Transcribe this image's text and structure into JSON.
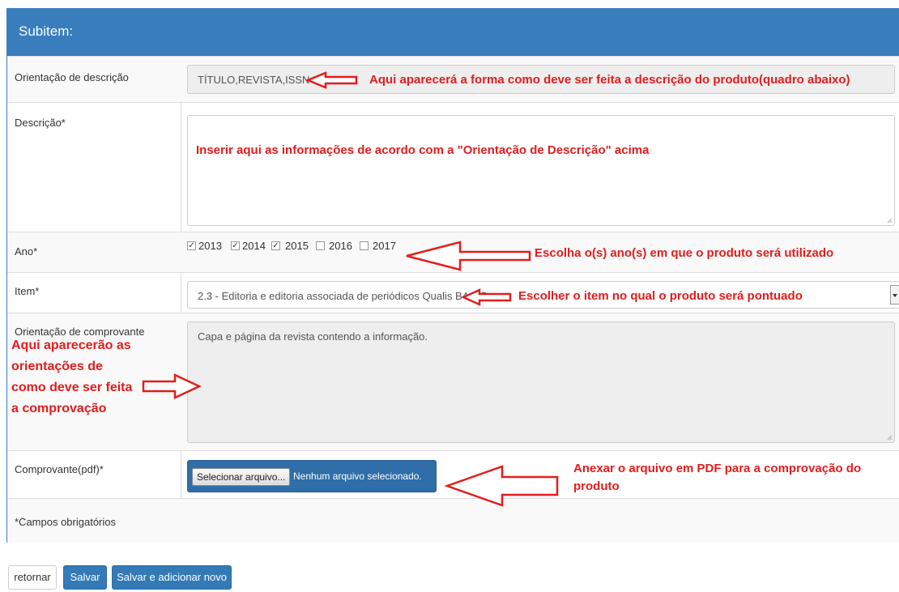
{
  "panel": {
    "title": "Subitem:"
  },
  "rows": {
    "orientacao_descricao": {
      "label": "Orientação de descrição",
      "value": "TÍTULO,REVISTA,ISSN"
    },
    "descricao": {
      "label": "Descrição*"
    },
    "ano": {
      "label": "Ano*",
      "years": [
        {
          "label": "2013",
          "checked": true
        },
        {
          "label": "2014",
          "checked": true
        },
        {
          "label": "2015",
          "checked": true
        },
        {
          "label": "2016",
          "checked": false
        },
        {
          "label": "2017",
          "checked": false
        }
      ]
    },
    "item": {
      "label": "Item*",
      "value": "2.3 - Editoria e editoria associada de periódicos Qualis B4, B5"
    },
    "orientacao_comprovante": {
      "label": "Orientação de comprovante",
      "value": "Capa e página da revista contendo a informação."
    },
    "comprovante": {
      "label": "Comprovante(pdf)*",
      "button": "Selecionar arquivo...",
      "status": "Nenhum arquivo selecionado."
    },
    "obrigatorios": {
      "label": "*Campos obrigatórios"
    }
  },
  "annotations": {
    "orientacao": "Aqui aparecerá a forma como deve ser feita a descrição do produto(quadro abaixo)",
    "descricao": "Inserir aqui as informações de acordo com a \"Orientação de Descrição\" acima",
    "ano": "Escolha o(s) ano(s) em que o produto será utilizado",
    "item": "Escolher o item no qual o produto será pontuado",
    "comprovante_lines": [
      "Aqui aparecerão as",
      "orientações de",
      "como deve ser feita",
      "a comprovação"
    ],
    "anexar_lines": [
      "Anexar o arquivo em PDF para a comprovação do",
      "produto"
    ]
  },
  "actions": {
    "retornar": "retornar",
    "salvar": "Salvar",
    "salvar_novo": "Salvar e adicionar novo"
  },
  "colors": {
    "header": "#3a7dbd",
    "primary": "#337ab7",
    "annotation": "#e21d1d"
  }
}
